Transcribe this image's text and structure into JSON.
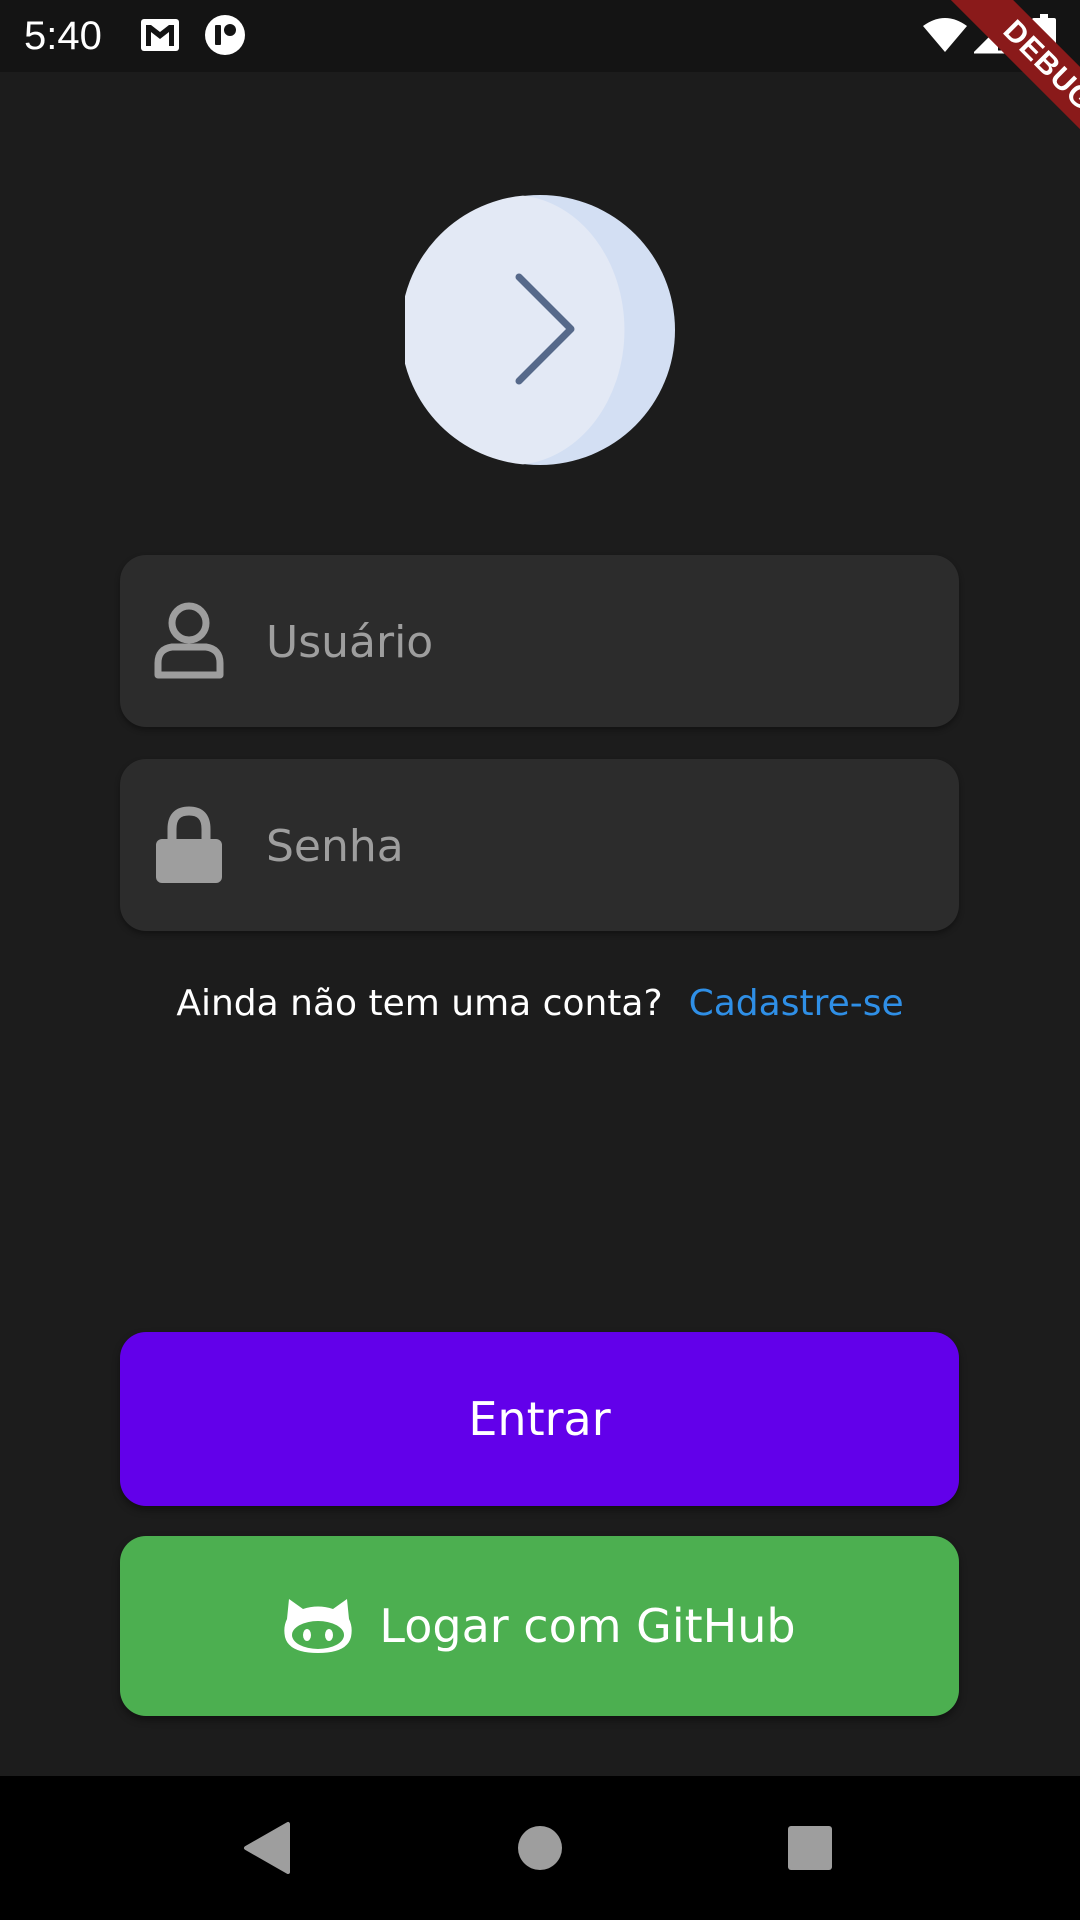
{
  "status_bar": {
    "time": "5:40",
    "icons": [
      "gmail-icon",
      "app-notification-icon",
      "wifi-icon",
      "signal-icon",
      "battery-icon"
    ]
  },
  "debug_banner": "DEBUG",
  "logo": {
    "icon": "chevron-right-icon",
    "colors": {
      "light": "#e3e9f5",
      "shade": "#d3dff3",
      "chevron": "#56698a"
    }
  },
  "login_form": {
    "username": {
      "placeholder": "Usuário",
      "value": "",
      "icon": "user-icon"
    },
    "password": {
      "placeholder": "Senha",
      "value": "",
      "icon": "lock-icon"
    }
  },
  "signup": {
    "question": "Ainda não tem uma conta?",
    "link": "Cadastre-se"
  },
  "buttons": {
    "enter_label": "Entrar",
    "github_label": "Logar com GitHub",
    "github_icon": "github-icon"
  },
  "colors": {
    "background": "#1c1c1c",
    "field_background": "#2c2c2c",
    "primary": "#6200ea",
    "github": "#4caf50",
    "link": "#2f8fe6"
  },
  "nav_bar": {
    "icons": [
      "back-icon",
      "home-icon",
      "recents-icon"
    ]
  }
}
